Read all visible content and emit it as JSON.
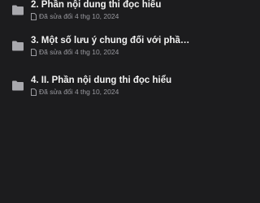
{
  "items": [
    {
      "title": "2. Phần nội dung thi đọc hiểu",
      "modified": "Đã sửa đổi 4 thg 10, 2024",
      "icon": "folder-icon"
    },
    {
      "title": "3. Một số lưu ý chung đối với phần nộ...",
      "modified": "Đã sửa đổi 4 thg 10, 2024",
      "icon": "folder-icon"
    },
    {
      "title": "4. II. Phần nội dung thi đọc hiểu",
      "modified": "Đã sửa đổi 4 thg 10, 2024",
      "icon": "folder-icon"
    }
  ],
  "colors": {
    "background": "#1c1c1e",
    "folder": "#a8a8ad",
    "title": "#f2f2f2",
    "meta": "#9a9aa0"
  }
}
